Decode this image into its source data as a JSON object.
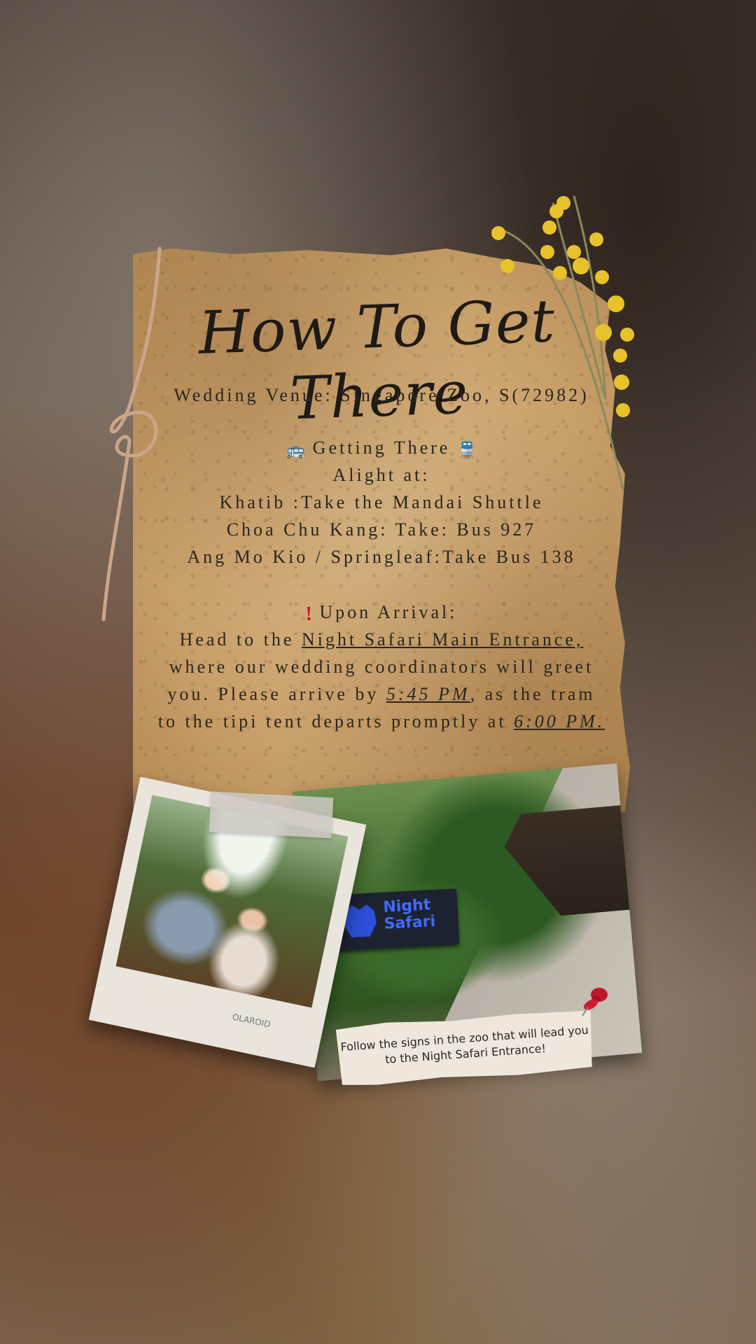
{
  "title": "How To Get There",
  "venue": "Wedding Venue: Singapore Zoo, S(72982)",
  "getting_there": {
    "heading": "Getting There",
    "icons": [
      "bus-icon",
      "train-icon"
    ],
    "alight": "Alight at:",
    "routes": [
      "Khatib :Take the Mandai Shuttle",
      "Choa Chu Kang: Take: Bus 927",
      "Ang Mo Kio / Springleaf:Take Bus 138"
    ]
  },
  "arrival": {
    "heading": "Upon Arrival:",
    "icon": "exclamation-icon",
    "line1_prefix": "Head to the ",
    "entrance": "Night Safari Main Entrance,",
    "line2": "where our wedding coordinators will greet",
    "line3_prefix": "you. Please arrive by ",
    "arrive_time": "5:45 PM",
    "line3_suffix": ", as the tram",
    "line4_prefix": "to the tipi tent departs promptly at ",
    "depart_time": "6:00 PM."
  },
  "photos": {
    "sign_text": "Night Safari",
    "polaroid_caption": "OLAROID",
    "note": "Follow the signs in the zoo that will lead you to the Night Safari Entrance!"
  },
  "colors": {
    "parchment": "#c9a06a",
    "ink": "#2a241d",
    "flowers": "#e8c22a",
    "pin": "#c0182a"
  }
}
